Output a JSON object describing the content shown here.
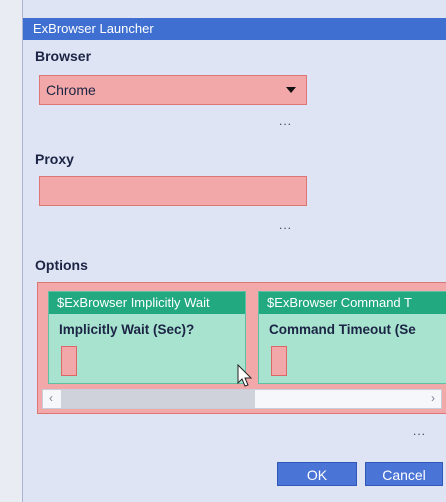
{
  "window": {
    "title": "ExBrowser Launcher"
  },
  "browser": {
    "label": "Browser",
    "selected": "Chrome"
  },
  "proxy": {
    "label": "Proxy",
    "value": ""
  },
  "options": {
    "label": "Options",
    "cards": [
      {
        "header": "$ExBrowser Implicitly Wait",
        "label": "Implicitly Wait (Sec)?"
      },
      {
        "header": "$ExBrowser Command T",
        "label": "Command Timeout (Se"
      }
    ]
  },
  "more": {
    "dots": "..."
  },
  "buttons": {
    "ok": "OK",
    "cancel": "Cancel"
  },
  "colors": {
    "field": "#f2a8a8",
    "card": "#a7e3cf",
    "card_header": "#22a97f",
    "titlebar": "#3f6fd1",
    "button": "#4a74d5"
  }
}
